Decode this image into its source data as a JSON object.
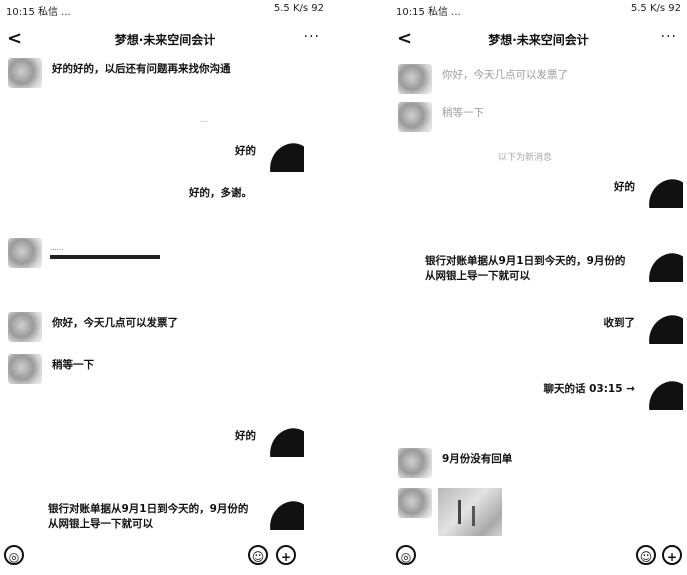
{
  "left": {
    "status": {
      "time": "10:15 私信 ...",
      "right": "5.5 K/s 92"
    },
    "title": "梦想·未来空间会计",
    "back": "<",
    "more": "···",
    "messages": [
      {
        "side": "l",
        "text": "好的好的，以后还有问题再来找你沟通"
      },
      {
        "side": "center",
        "text": "..."
      },
      {
        "side": "r",
        "text": "好的"
      },
      {
        "side": "plain_r",
        "text": "好的，多谢。"
      },
      {
        "side": "link",
        "text": "......"
      },
      {
        "side": "l",
        "text": "你好，今天几点可以发票了"
      },
      {
        "side": "l",
        "text": "稍等一下"
      },
      {
        "side": "r",
        "text": "好的"
      },
      {
        "side": "r",
        "text": "银行对账单据从9月1日到今天的，9月份的从网银上导一下就可以"
      }
    ],
    "toolbar": {
      "voice": "◎",
      "emoji": "☺",
      "add": "+"
    }
  },
  "right": {
    "status": {
      "time": "10:15 私信 ...",
      "right": "5.5 K/s 92"
    },
    "title": "梦想·未来空间会计",
    "back": "<",
    "more": "···",
    "messages": [
      {
        "side": "l",
        "text": "你好，今天几点可以发票了"
      },
      {
        "side": "l",
        "text": "稍等一下"
      },
      {
        "side": "center",
        "text": "以下为新消息"
      },
      {
        "side": "r",
        "text": "好的"
      },
      {
        "side": "r",
        "text": "银行对账单据从9月1日到今天的，9月份的从网银上导一下就可以"
      },
      {
        "side": "r",
        "text": "收到了"
      },
      {
        "side": "r",
        "text": "聊天的话 03:15 →"
      },
      {
        "side": "l",
        "text": "9月份没有回单"
      }
    ],
    "toolbar": {
      "voice": "◎",
      "emoji": "☺",
      "add": "+"
    }
  }
}
